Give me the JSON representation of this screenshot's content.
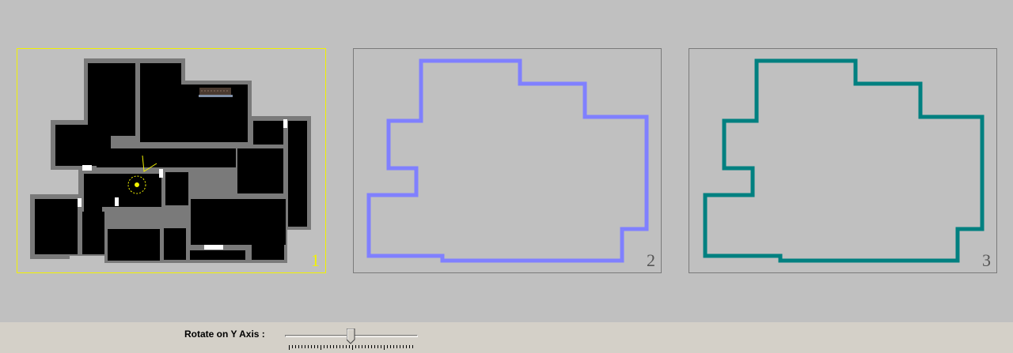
{
  "viewports": [
    {
      "number": "1",
      "selected": true,
      "render": "filled-floorplan"
    },
    {
      "number": "2",
      "selected": false,
      "render": "outline",
      "outline_color": "#8080ff"
    },
    {
      "number": "3",
      "selected": false,
      "render": "outline",
      "outline_color": "#008080"
    }
  ],
  "colors": {
    "background": "#c0c0c0",
    "toolbar": "#d4d0c8",
    "selected_border": "#f2f200",
    "wall": "#7a7a7a",
    "room": "#000000",
    "doorway": "#ffffff",
    "player_marker": "#f2f200"
  },
  "icons": {
    "player": "player-marker-icon",
    "camera": "camera-view-icon"
  },
  "controls": {
    "rotate_label": "Rotate on Y Axis :",
    "rotate_value": 0.5
  }
}
